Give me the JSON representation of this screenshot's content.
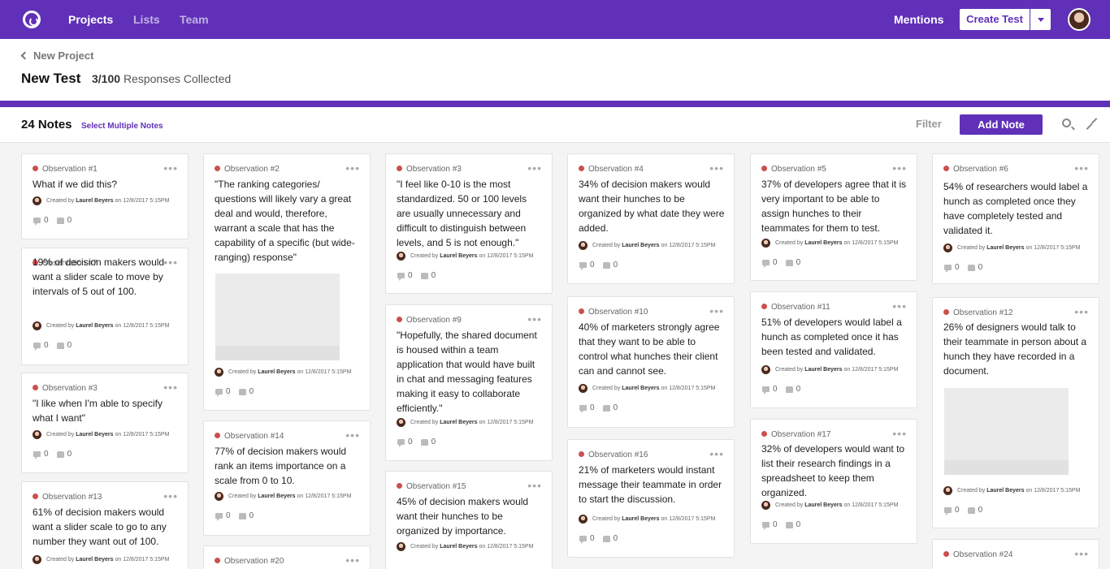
{
  "nav": {
    "links": [
      "Projects",
      "Lists",
      "Team"
    ],
    "mentions": "Mentions",
    "create_test": "Create Test"
  },
  "header": {
    "back_label": "New Project",
    "title": "New Test",
    "responses_count": "3/100",
    "responses_label": "Responses Collected"
  },
  "notes_bar": {
    "count": "24 Notes",
    "select_multiple": "Select Multiple Notes",
    "filter": "Filter",
    "add_note": "Add Note"
  },
  "card_meta": {
    "prefix": "Created by",
    "author": "Laurel Beyers",
    "date": "on 12/8/2017 5:15PM"
  },
  "cards": [
    {
      "label": "Observation #1",
      "text": "What if we did this?",
      "comments": "0",
      "likes": "0"
    },
    {
      "label": "Observation #7",
      "text": "19% of decision makers would want a slider scale to move by intervals of 5 out of 100.",
      "comments": "0",
      "likes": "0"
    },
    {
      "label": "Observation #3",
      "text": "\"I like when I'm able to specify what I want\"",
      "comments": "0",
      "likes": "0"
    },
    {
      "label": "Observation #13",
      "text": "61% of decision makers would want a slider scale to go to any number they want out of 100.",
      "comments": "",
      "likes": ""
    },
    {
      "label": "Observation #2",
      "text": "\"The ranking categories/ questions will likely vary a great deal and would, therefore, warrant a scale that has the capability of a specific (but wide-ranging) response\"",
      "comments": "0",
      "likes": "0"
    },
    {
      "label": "Observation #14",
      "text": "77% of decision makers would rank an items importance on a scale from 0 to 10.",
      "comments": "0",
      "likes": "0"
    },
    {
      "label": "Observation #20",
      "text": "",
      "comments": "",
      "likes": ""
    },
    {
      "label": "Observation #3",
      "text": "\"I feel like 0-10 is the most standardized. 50 or 100 levels are usually unnecessary and difficult to distinguish between levels, and 5 is not enough.\"",
      "comments": "0",
      "likes": "0"
    },
    {
      "label": "Observation #9",
      "text": "\"Hopefully, the shared document is housed within a team application that would have built in chat and messaging features making it easy to collaborate efficiently.\"",
      "comments": "0",
      "likes": "0"
    },
    {
      "label": "Observation #15",
      "text": "45% of decision makers would want their hunches to be organized by importance.",
      "comments": "",
      "likes": ""
    },
    {
      "label": "Observation #4",
      "text": "34% of decision makers would want their hunches to be organized by what date they were added.",
      "comments": "0",
      "likes": "0"
    },
    {
      "label": "Observation #10",
      "text": "40% of marketers strongly agree that they want to be able to control what hunches their client can and cannot see.",
      "comments": "0",
      "likes": "0"
    },
    {
      "label": "Observation #16",
      "text": "21% of marketers would instant message their teammate in order to start the discussion.",
      "comments": "0",
      "likes": "0"
    },
    {
      "label": "Observation #5",
      "text": "37% of developers agree that it is very important to be able to assign hunches to their teammates for them to test.",
      "comments": "0",
      "likes": "0"
    },
    {
      "label": "Observation #11",
      "text": "51% of developers would label a hunch as completed once it has been tested and validated.",
      "comments": "0",
      "likes": "0"
    },
    {
      "label": "Observation #17",
      "text": "32% of developers would want to list their research findings in a spreadsheet to keep them organized.",
      "comments": "0",
      "likes": "0"
    },
    {
      "label": "Observation #6",
      "text": "54% of researchers would label a hunch as completed once they have completely tested and validated it.",
      "comments": "0",
      "likes": "0"
    },
    {
      "label": "Observation #12",
      "text": "26% of designers would talk to their teammate in person about a hunch they have recorded in a document.",
      "comments": "0",
      "likes": "0"
    },
    {
      "label": "Observation #24",
      "text": "",
      "comments": "",
      "likes": ""
    }
  ]
}
